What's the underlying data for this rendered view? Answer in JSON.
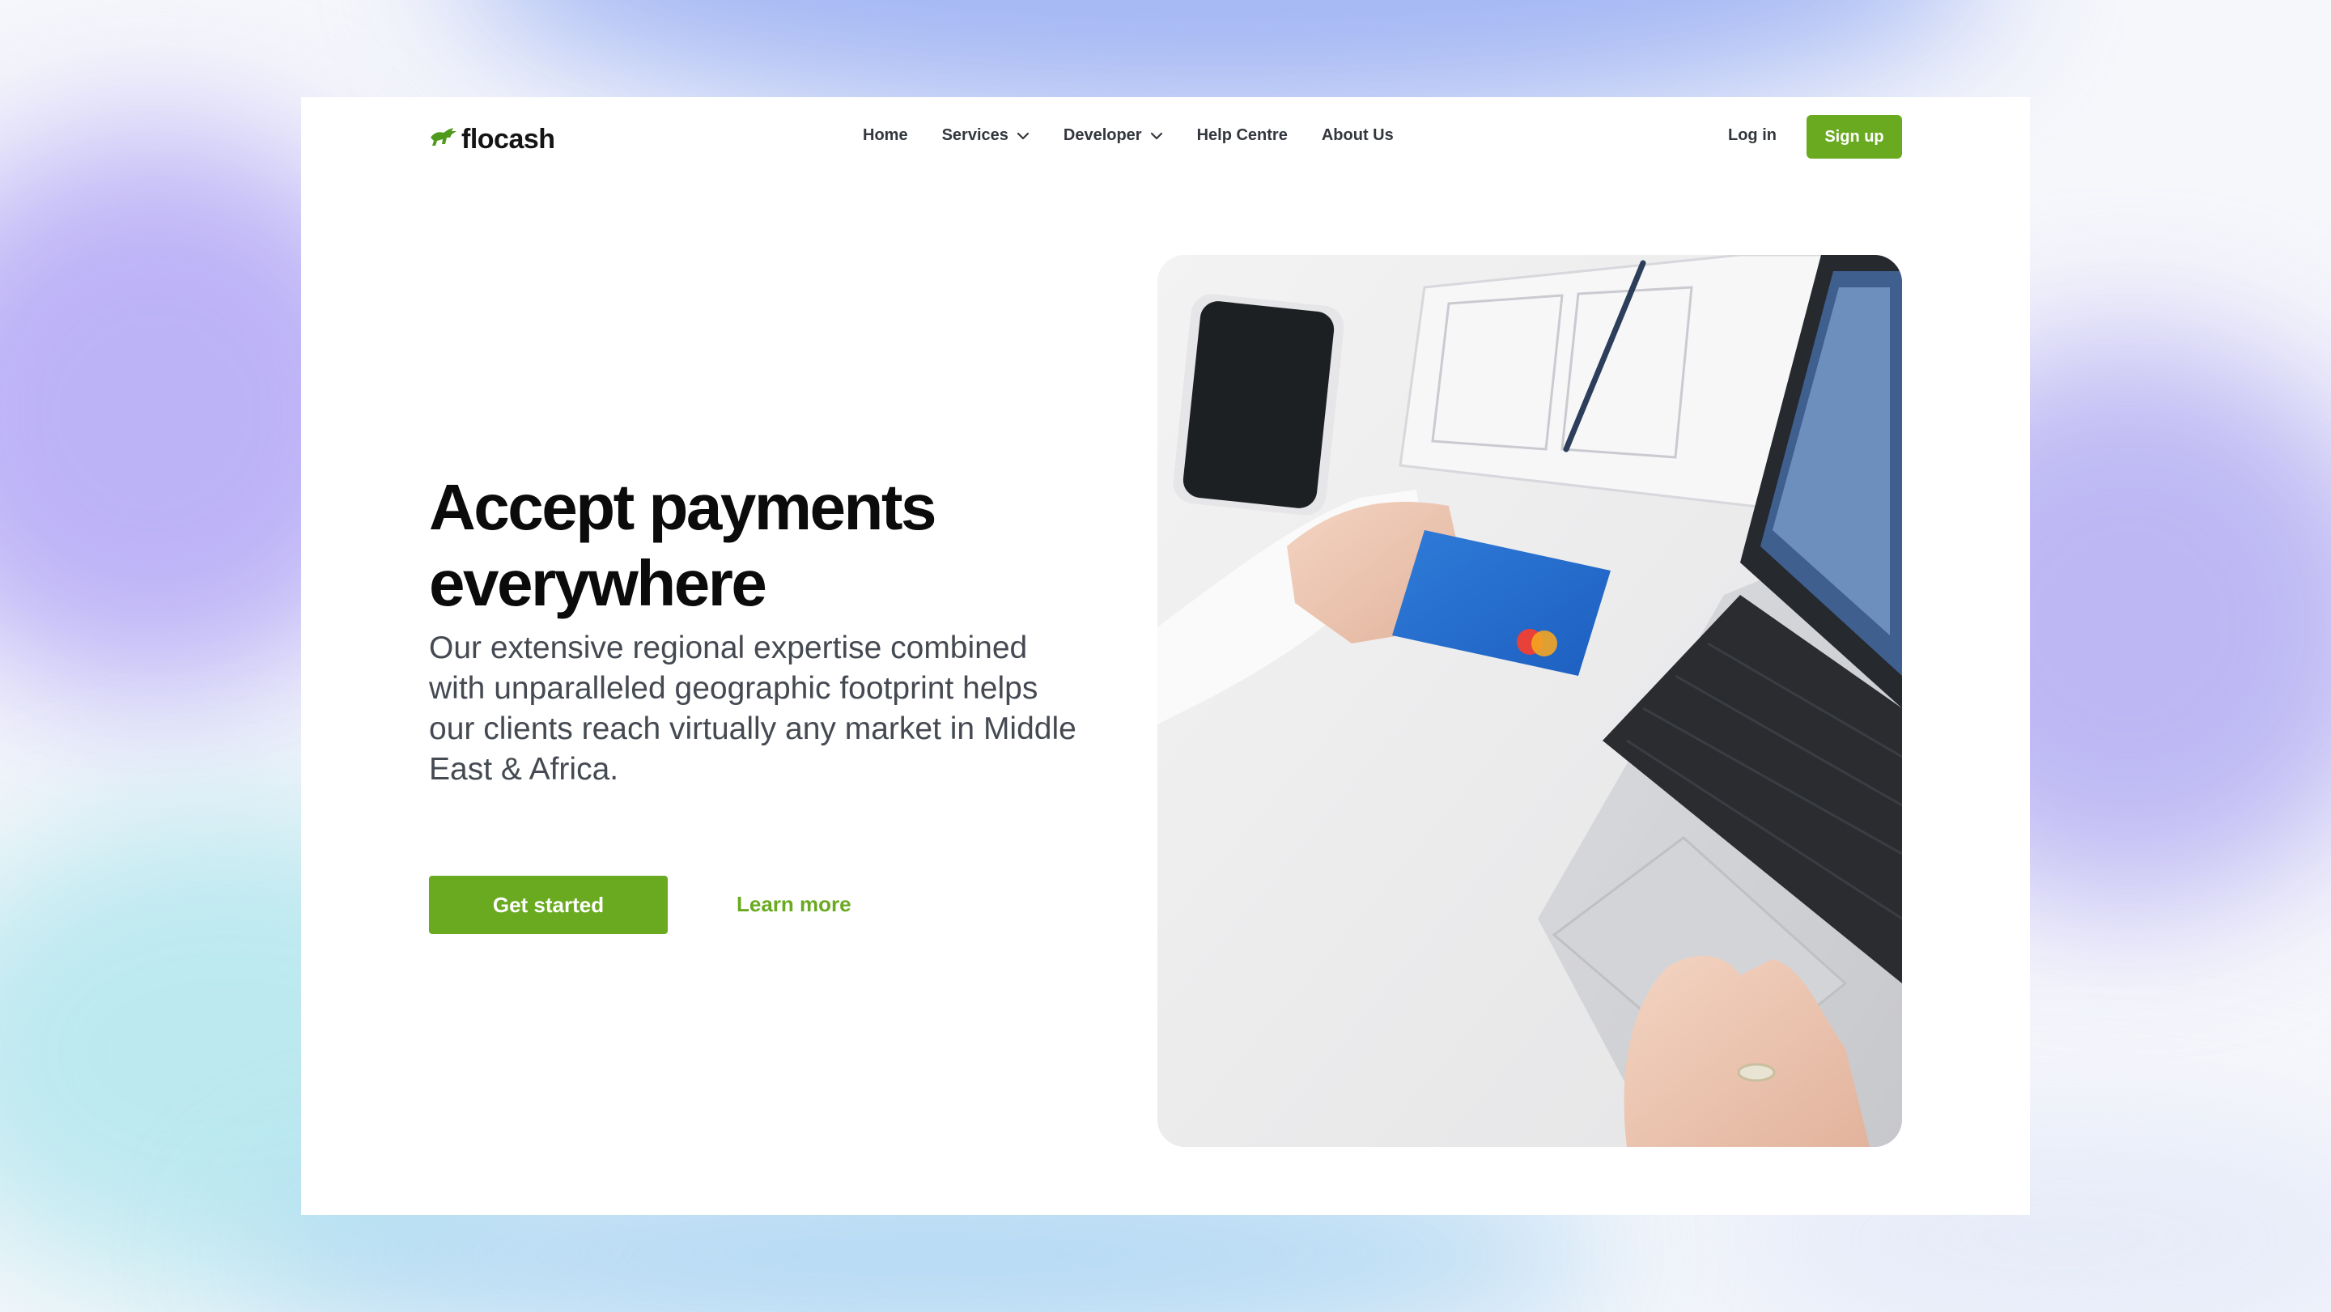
{
  "brand": {
    "name": "flocash"
  },
  "nav": {
    "items": [
      {
        "label": "Home",
        "has_dropdown": false
      },
      {
        "label": "Services",
        "has_dropdown": true
      },
      {
        "label": "Developer",
        "has_dropdown": true
      },
      {
        "label": "Help Centre",
        "has_dropdown": false
      },
      {
        "label": "About Us",
        "has_dropdown": false
      }
    ],
    "login_label": "Log in",
    "signup_label": "Sign up"
  },
  "hero": {
    "title": "Accept payments everywhere",
    "subtitle": "Our extensive regional expertise combined with unparalleled geographic footprint helps our clients reach virtually any market in Middle East & Africa.",
    "primary_cta": "Get started",
    "secondary_cta": "Learn more"
  },
  "colors": {
    "accent": "#6aaa20",
    "text_dark": "#0b0b0c",
    "text_body": "#454a52",
    "nav_text": "#33373d"
  },
  "icons": {
    "logo": "leaping-antelope-icon",
    "dropdown": "chevron-down-icon"
  }
}
